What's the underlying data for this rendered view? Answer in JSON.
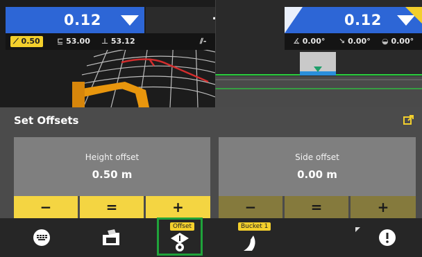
{
  "left_panel": {
    "value": "0.12",
    "slope": "0.50",
    "elev1": "53.00",
    "elev2": "53.12"
  },
  "center_panel": {
    "dash_top": "-",
    "dash_info": "-"
  },
  "right_panel": {
    "value": "0.12",
    "angle1": "0.00°",
    "angle2": "0.00°",
    "angle3": "0.00°"
  },
  "offsets": {
    "title": "Set Offsets",
    "height_label": "Height offset",
    "height_value": "0.50 m",
    "side_label": "Side offset",
    "side_value": "0.00 m",
    "minus": "−",
    "equals": "=",
    "plus": "+"
  },
  "toolbar": {
    "offset_tag": "Offset",
    "bucket_tag": "Bucket 1",
    "icons": [
      "keyboard-icon",
      "folder-icon",
      "offset-icon",
      "bucket-icon",
      "alert-icon"
    ]
  },
  "colors": {
    "accent_blue": "#2d66d6",
    "yellow": "#f4d542",
    "olive": "#857a3d",
    "highlight_green": "#1fa33a"
  }
}
